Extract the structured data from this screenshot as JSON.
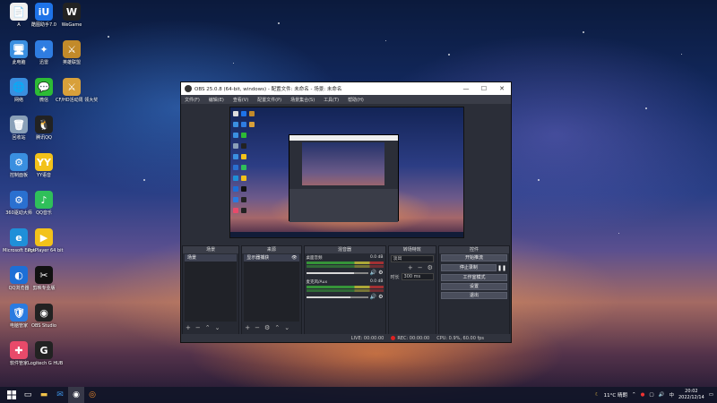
{
  "desktop": {
    "icons": [
      {
        "name": "a-icon",
        "label": "A",
        "glyph": "📄",
        "color": "#f0f0f0"
      },
      {
        "name": "kugou-icon",
        "label": "酷图助手7.0",
        "glyph": "iU",
        "color": "#1e73e8"
      },
      {
        "name": "wegame-icon",
        "label": "WeGame",
        "glyph": "W",
        "color": "#222"
      },
      {
        "name": "this-pc-icon",
        "label": "此电脑",
        "glyph": "🖥",
        "color": "#3a8fe0"
      },
      {
        "name": "xunlei-icon",
        "label": "迅雷",
        "glyph": "✦",
        "color": "#2f7de1"
      },
      {
        "name": "lol-icon",
        "label": "英雄联盟",
        "glyph": "⚔",
        "color": "#c28a2a"
      },
      {
        "name": "network-icon",
        "label": "网络",
        "glyph": "🌐",
        "color": "#3a8fe0"
      },
      {
        "name": "wechat-icon",
        "label": "微信",
        "glyph": "💬",
        "color": "#2dbb35"
      },
      {
        "name": "cf-icon",
        "label": "CF/HD活动周 领大奖",
        "glyph": "⚔",
        "color": "#d8a03a"
      },
      {
        "name": "recycle-bin-icon",
        "label": "回收站",
        "glyph": "🗑",
        "color": "#8aa0b8"
      },
      {
        "name": "qq-icon",
        "label": "腾讯QQ",
        "glyph": "🐧",
        "color": "#222"
      },
      {
        "name": "control-panel-icon",
        "label": "控制面板",
        "glyph": "⚙",
        "color": "#3a8fe0"
      },
      {
        "name": "yy-icon",
        "label": "YY语音",
        "glyph": "YY",
        "color": "#f2c21a"
      },
      {
        "name": "360-icon",
        "label": "360驱动大师",
        "glyph": "⚙",
        "color": "#2a70d0"
      },
      {
        "name": "qqmusic-icon",
        "label": "QQ音乐",
        "glyph": "♪",
        "color": "#2fbf5a"
      },
      {
        "name": "edge-icon",
        "label": "Microsoft Edge",
        "glyph": "e",
        "color": "#1f8fd8"
      },
      {
        "name": "potplayer-icon",
        "label": "PotPlayer 64 bit",
        "glyph": "▶",
        "color": "#f3c21a"
      },
      {
        "name": "qq-browser-icon",
        "label": "QQ浏览器",
        "glyph": "◐",
        "color": "#1d6fd6"
      },
      {
        "name": "capcut-icon",
        "label": "剪映专业版",
        "glyph": "✂",
        "color": "#111"
      },
      {
        "name": "tencent-pc-icon",
        "label": "电脑管家",
        "glyph": "🛡",
        "color": "#2a7be0"
      },
      {
        "name": "obs-icon",
        "label": "OBS Studio",
        "glyph": "◉",
        "color": "#222"
      },
      {
        "name": "software-manager-icon",
        "label": "软件管家",
        "glyph": "✚",
        "color": "#e84a6a"
      },
      {
        "name": "logitech-icon",
        "label": "Logitech G HUB",
        "glyph": "G",
        "color": "#222"
      }
    ]
  },
  "obs": {
    "title": "OBS 25.0.8 (64-bit, windows) - 配置文件: 未命名 - 场景: 未命名",
    "window_buttons": [
      "—",
      "☐",
      "✕"
    ],
    "menu": [
      "文件(F)",
      "编辑(E)",
      "查看(V)",
      "配置文件(P)",
      "场景集合(S)",
      "工具(T)",
      "帮助(H)"
    ],
    "docks": {
      "scenes": {
        "title": "场景",
        "items": [
          "场景"
        ]
      },
      "sources": {
        "title": "来源",
        "items": [
          "显示器捕获"
        ]
      },
      "mixer": {
        "title": "混音器",
        "tracks": [
          {
            "name": "桌面音频",
            "db": "0.0 dB",
            "level": 0.78
          },
          {
            "name": "麦克风/Aux",
            "db": "0.0 dB",
            "level": 0.72
          }
        ]
      },
      "transitions": {
        "title": "转场特效",
        "type": "淡出",
        "duration_label": "时长",
        "duration": "300 ms"
      },
      "controls": {
        "title": "控件",
        "buttons": [
          "开始推流",
          "停止录制",
          "工作室模式",
          "设置",
          "退出"
        ]
      }
    },
    "status": {
      "live": "LIVE: 00:00:00",
      "rec": "REC: 00:00:00",
      "cpu": "CPU: 0.9%, 60.00 fps"
    }
  },
  "taskbar": {
    "weather": "11°C 晴朗",
    "ime": "中",
    "time": "20:02",
    "date": "2022/12/14"
  }
}
